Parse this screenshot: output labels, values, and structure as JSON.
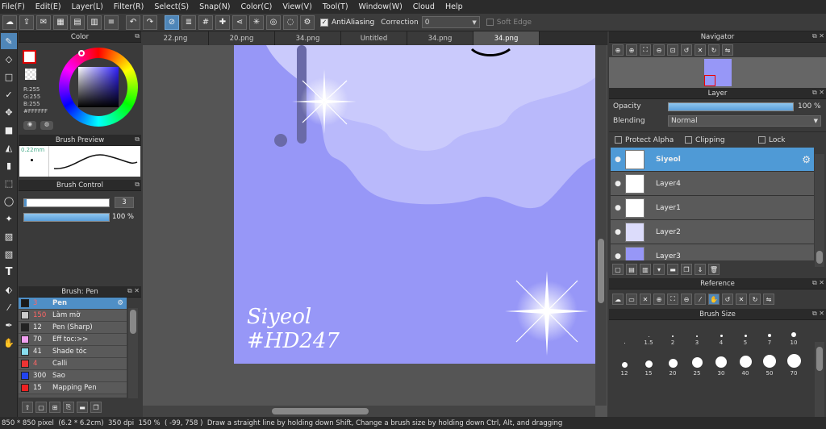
{
  "menu": [
    "File(F)",
    "Edit(E)",
    "Layer(L)",
    "Filter(R)",
    "Select(S)",
    "Snap(N)",
    "Color(C)",
    "View(V)",
    "Tool(T)",
    "Window(W)",
    "Cloud",
    "Help"
  ],
  "toolbar": {
    "antialiasing_label": "AntiAliasing",
    "correction_label": "Correction",
    "correction_value": "0",
    "soft_edge_label": "Soft Edge"
  },
  "tabs": [
    "22.png",
    "20.png",
    "34.png",
    "Untitled",
    "34.png",
    "34.png"
  ],
  "color_panel": {
    "title": "Color",
    "r": "R:255",
    "g": "G:255",
    "b": "B:255",
    "hex": "#FFFFFF"
  },
  "brush_preview": {
    "title": "Brush Preview",
    "size_label": "0.22mm"
  },
  "brush_control": {
    "title": "Brush Control",
    "size_value": "3",
    "opacity_value": "100 %",
    "size_fill": 0.03,
    "opacity_fill": 1.0
  },
  "brush_list": {
    "title": "Brush: Pen",
    "items": [
      {
        "size": "3",
        "name": "Pen",
        "color": "#1a1a1a"
      },
      {
        "size": "150",
        "name": "Làm mờ",
        "color": "#cccccc"
      },
      {
        "size": "12",
        "name": "Pen (Sharp)",
        "color": "#222222"
      },
      {
        "size": "70",
        "name": "Eff toc:>>",
        "color": "#f0a0f0"
      },
      {
        "size": "41",
        "name": "Shade tóc",
        "color": "#88ddee"
      },
      {
        "size": "4",
        "name": "Calli",
        "color": "#ee3333"
      },
      {
        "size": "300",
        "name": "Sao",
        "color": "#2244ee"
      },
      {
        "size": "15",
        "name": "Mapping Pen",
        "color": "#ee2222"
      }
    ]
  },
  "canvas": {
    "signature_line1": "Siyeol",
    "signature_line2": "#HD247",
    "bg_color": "#9797f7"
  },
  "navigator": {
    "title": "Navigator"
  },
  "layer_panel": {
    "title": "Layer",
    "opacity_label": "Opacity",
    "opacity_value": "100 %",
    "opacity_fill": 1.0,
    "blending_label": "Blending",
    "blending_value": "Normal",
    "protect_alpha": "Protect Alpha",
    "clipping": "Clipping",
    "lock": "Lock",
    "layers": [
      {
        "name": "Siyeol",
        "selected": true
      },
      {
        "name": "Layer4",
        "selected": false
      },
      {
        "name": "Layer1",
        "selected": false
      },
      {
        "name": "Layer2",
        "selected": false
      },
      {
        "name": "Layer3",
        "selected": false
      }
    ]
  },
  "reference": {
    "title": "Reference"
  },
  "brush_size": {
    "title": "Brush Size",
    "row1": [
      ".",
      "1.5",
      "2",
      "3",
      "4",
      "5",
      "7",
      "10"
    ],
    "row2": [
      "12",
      "15",
      "20",
      "25",
      "30",
      "40",
      "50",
      "70"
    ]
  },
  "status": {
    "dims": "850 * 850 pixel",
    "cm": "(6.2 * 6.2cm)",
    "dpi": "350 dpi",
    "zoom": "150 %",
    "coords": "( -99, 758 )",
    "hint": "Draw a straight line by holding down Shift, Change a brush size by holding down Ctrl, Alt, and dragging"
  }
}
